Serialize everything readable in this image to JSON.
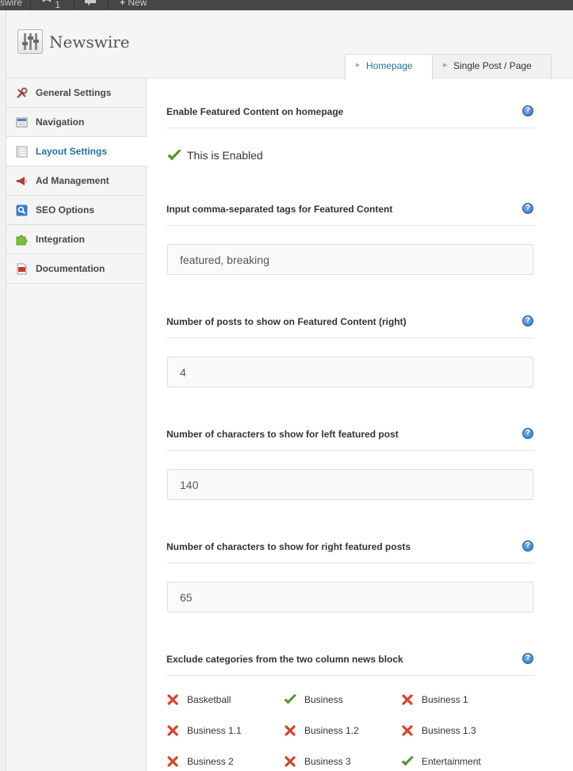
{
  "admin_bar": {
    "site_name": "swire",
    "updates": "1",
    "new_label": "New"
  },
  "header": {
    "title": "Newswire",
    "logo_icon": "sliders-logo-icon"
  },
  "tabs": [
    {
      "label": "Homepage",
      "active": true
    },
    {
      "label": "Single Post / Page",
      "active": false
    }
  ],
  "sidebar": {
    "items": [
      {
        "label": "General Settings",
        "icon": "wrench-icon"
      },
      {
        "label": "Navigation",
        "icon": "navigation-icon"
      },
      {
        "label": "Layout Settings",
        "icon": "layout-icon",
        "active": true
      },
      {
        "label": "Ad Management",
        "icon": "megaphone-icon"
      },
      {
        "label": "SEO Options",
        "icon": "search-icon"
      },
      {
        "label": "Integration",
        "icon": "puzzle-icon"
      },
      {
        "label": "Documentation",
        "icon": "pdf-icon"
      }
    ]
  },
  "settings": {
    "featured": {
      "title": "Enable Featured Content on homepage",
      "status": "This is Enabled"
    },
    "tags": {
      "title": "Input comma-separated tags for Featured Content",
      "value": "featured, breaking"
    },
    "num_posts": {
      "title": "Number of posts to show on Featured Content (right)",
      "value": "4"
    },
    "left_chars": {
      "title": "Number of characters to show for left featured post",
      "value": "140"
    },
    "right_chars": {
      "title": "Number of characters to show for right featured posts",
      "value": "65"
    },
    "exclude": {
      "title": "Exclude categories from the two column news block",
      "categories": [
        {
          "label": "Basketball",
          "included": false
        },
        {
          "label": "Business",
          "included": true
        },
        {
          "label": "Business 1",
          "included": false
        },
        {
          "label": "Business 1.1",
          "included": false
        },
        {
          "label": "Business 1.2",
          "included": false
        },
        {
          "label": "Business 1.3",
          "included": false
        },
        {
          "label": "Business 2",
          "included": false
        },
        {
          "label": "Business 3",
          "included": false
        },
        {
          "label": "Entertainment",
          "included": true
        }
      ]
    }
  },
  "colors": {
    "accent": "#21759b",
    "check_green": "#5aa02c",
    "cross_red": "#d9432b",
    "help_blue": "#2d6fb7"
  }
}
